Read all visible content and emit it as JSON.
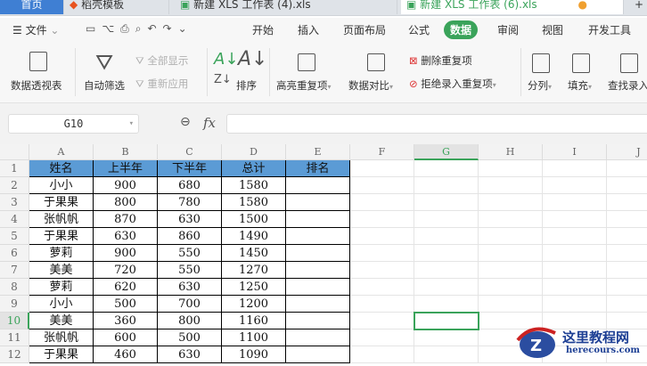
{
  "tabs": [
    {
      "label": "首页"
    },
    {
      "label": "稻壳模板"
    },
    {
      "label": "新建 XLS 工作表 (4).xls"
    },
    {
      "label": "新建 XLS 工作表 (6).xls"
    }
  ],
  "menu": {
    "file": "文件",
    "tabs": [
      "开始",
      "插入",
      "页面布局",
      "公式",
      "数据",
      "审阅",
      "视图",
      "开发工具"
    ],
    "active": "数据"
  },
  "ribbon": {
    "pivot": "数据透视表",
    "autofilter": "自动筛选",
    "show_all": "全部显示",
    "reapply": "重新应用",
    "sort": "排序",
    "highlight_dup": "高亮重复项",
    "compare": "数据对比",
    "remove_dup": "删除重复项",
    "reject_dup": "拒绝录入重复项",
    "split": "分列",
    "fill": "填充",
    "find_entry": "查找录入"
  },
  "formula_bar": {
    "name_box": "G10",
    "formula": ""
  },
  "columns": [
    "A",
    "B",
    "C",
    "D",
    "E",
    "F",
    "G",
    "H",
    "I",
    "J"
  ],
  "rows": [
    "1",
    "2",
    "3",
    "4",
    "5",
    "6",
    "7",
    "8",
    "9",
    "10",
    "11",
    "12"
  ],
  "selected_cell": "G10",
  "table": {
    "headers": [
      "姓名",
      "上半年",
      "下半年",
      "总计",
      "排名"
    ],
    "data": [
      [
        "小小",
        "900",
        "680",
        "1580",
        ""
      ],
      [
        "于果果",
        "800",
        "780",
        "1580",
        ""
      ],
      [
        "张帆帆",
        "870",
        "630",
        "1500",
        ""
      ],
      [
        "于果果",
        "630",
        "860",
        "1490",
        ""
      ],
      [
        "萝莉",
        "900",
        "550",
        "1450",
        ""
      ],
      [
        "美美",
        "720",
        "550",
        "1270",
        ""
      ],
      [
        "萝莉",
        "620",
        "630",
        "1250",
        ""
      ],
      [
        "小小",
        "500",
        "700",
        "1200",
        ""
      ],
      [
        "美美",
        "360",
        "800",
        "1160",
        ""
      ],
      [
        "张帆帆",
        "600",
        "500",
        "1100",
        ""
      ],
      [
        "于果果",
        "460",
        "630",
        "1090",
        ""
      ]
    ]
  },
  "colors": {
    "accent": "#3aa35a",
    "header_fill": "#5b9bd5"
  },
  "watermark": {
    "title": "这里教程网",
    "url": "herecours.com"
  }
}
